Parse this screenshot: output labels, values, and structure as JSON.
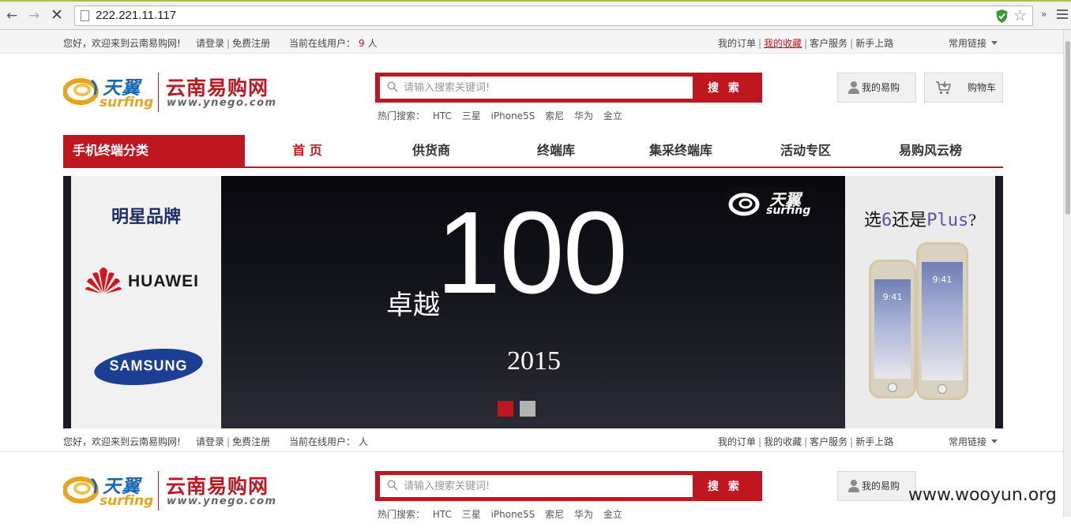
{
  "browser": {
    "url": "222.221.11.117",
    "icons": [
      "back-icon",
      "forward-icon",
      "stop-icon",
      "page-icon",
      "shield-icon",
      "star-icon",
      "menu-icon"
    ]
  },
  "topbar": {
    "welcome": "您好，欢迎来到云南易购网!",
    "login": "请登录",
    "register": "免费注册",
    "online_label": "当前在线用户：",
    "online_count": "9",
    "online_unit": "人",
    "links": [
      "我的订单",
      "我的收藏",
      "客户服务",
      "新手上路"
    ],
    "common_links": "常用链接"
  },
  "topbar2": {
    "online_label": "当前在线用户：",
    "online_count": "",
    "online_unit": "人"
  },
  "logo": {
    "tianyi": "天翼",
    "surfing": "surfing",
    "site_name": "云南易购网",
    "domain": "www.ynego.com"
  },
  "search": {
    "placeholder": "请输入搜索关键词!",
    "button": "搜 索",
    "hot_label": "热门搜索：",
    "hot_keywords": [
      "HTC",
      "三星",
      "iPhone5S",
      "索尼",
      "华为",
      "金立"
    ]
  },
  "account": {
    "mine": "我的易购",
    "cart": "购物车"
  },
  "nav": {
    "category": "手机终端分类",
    "items": [
      "首 页",
      "供货商",
      "终端库",
      "集采终端库",
      "活动专区",
      "易购风云榜"
    ]
  },
  "banner": {
    "brands_title": "明星品牌",
    "brand1": "HUAWEI",
    "brand2": "SAMSUNG",
    "hero_prefix": "卓越",
    "hero_number": "100",
    "hero_year": "2015",
    "hero_logo_cn": "天翼",
    "hero_logo_en": "surfing",
    "promo_a": "选",
    "promo_b": "6",
    "promo_c": "还是",
    "promo_d": "Plus",
    "promo_e": "?",
    "phone_time": "9:41",
    "slides_total": 2,
    "slide_active": 1
  },
  "watermark": "www.wooyun.org",
  "colors": {
    "brand_red": "#c0161f",
    "brand_blue": "#1a67b4",
    "brand_orange": "#e8a320",
    "browser_accent": "#a6c24a"
  }
}
